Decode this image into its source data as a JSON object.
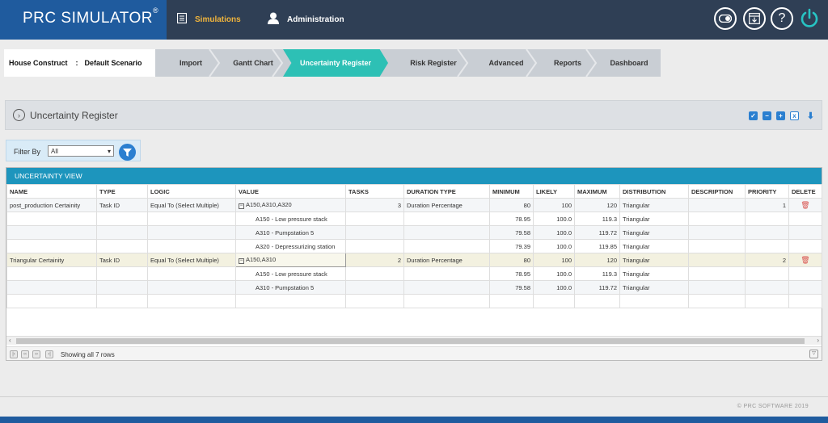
{
  "app": {
    "title": "PRC SIMULATOR",
    "registered": "®"
  },
  "nav": {
    "simulations": "Simulations",
    "administration": "Administration"
  },
  "project": {
    "name": "House Construct",
    "separator": ":",
    "scenario": "Default Scenario"
  },
  "steps": [
    "Import",
    "Gantt Chart",
    "Uncertainty Register",
    "Risk Register",
    "Advanced",
    "Reports",
    "Dashboard"
  ],
  "active_step": "Uncertainty Register",
  "panel": {
    "title": "Uncertainty Register"
  },
  "filter": {
    "label": "Filter By",
    "value": "All"
  },
  "grid": {
    "caption": "UNCERTAINTY VIEW",
    "columns": [
      "NAME",
      "TYPE",
      "LOGIC",
      "VALUE",
      "TASKS",
      "DURATION TYPE",
      "MINIMUM",
      "LIKELY",
      "MAXIMUM",
      "DISTRIBUTION",
      "DESCRIPTION",
      "PRIORITY",
      "DELETE"
    ],
    "rows": [
      {
        "name": "post_production Certainity",
        "type": "Task ID",
        "logic": "Equal To (Select Multiple)",
        "value": "A150,A310,A320",
        "tasks": "3",
        "duration_type": "Duration Percentage",
        "min": "80",
        "likely": "100",
        "max": "120",
        "dist": "Triangular",
        "priority": "1"
      },
      {
        "value": "A150 - Low pressure stack",
        "min": "78.95",
        "likely": "100.0",
        "max": "119.3",
        "dist": "Triangular"
      },
      {
        "value": "A310 - Pumpstation 5",
        "min": "79.58",
        "likely": "100.0",
        "max": "119.72",
        "dist": "Triangular"
      },
      {
        "value": "A320 - Depressurizing station",
        "min": "79.39",
        "likely": "100.0",
        "max": "119.85",
        "dist": "Triangular"
      },
      {
        "name": "Triangular Certainity",
        "type": "Task ID",
        "logic": "Equal To (Select Multiple)",
        "value": "A150,A310",
        "tasks": "2",
        "duration_type": "Duration Percentage",
        "min": "80",
        "likely": "100",
        "max": "120",
        "dist": "Triangular",
        "priority": "2"
      },
      {
        "value": "A150 - Low pressure stack",
        "min": "78.95",
        "likely": "100.0",
        "max": "119.3",
        "dist": "Triangular"
      },
      {
        "value": "A310 - Pumpstation 5",
        "min": "79.58",
        "likely": "100.0",
        "max": "119.72",
        "dist": "Triangular"
      }
    ]
  },
  "pager": {
    "status": "Showing all 7 rows"
  },
  "footer": {
    "copyright": "© PRC SOFTWARE 2019"
  },
  "colors": {
    "topbar": "#2f3f55",
    "logo_bg": "#1f5b9e",
    "active_step": "#2dc0b5",
    "accent": "#2b7fd0",
    "caption": "#1d95bd",
    "nav_active": "#f0b43c"
  }
}
